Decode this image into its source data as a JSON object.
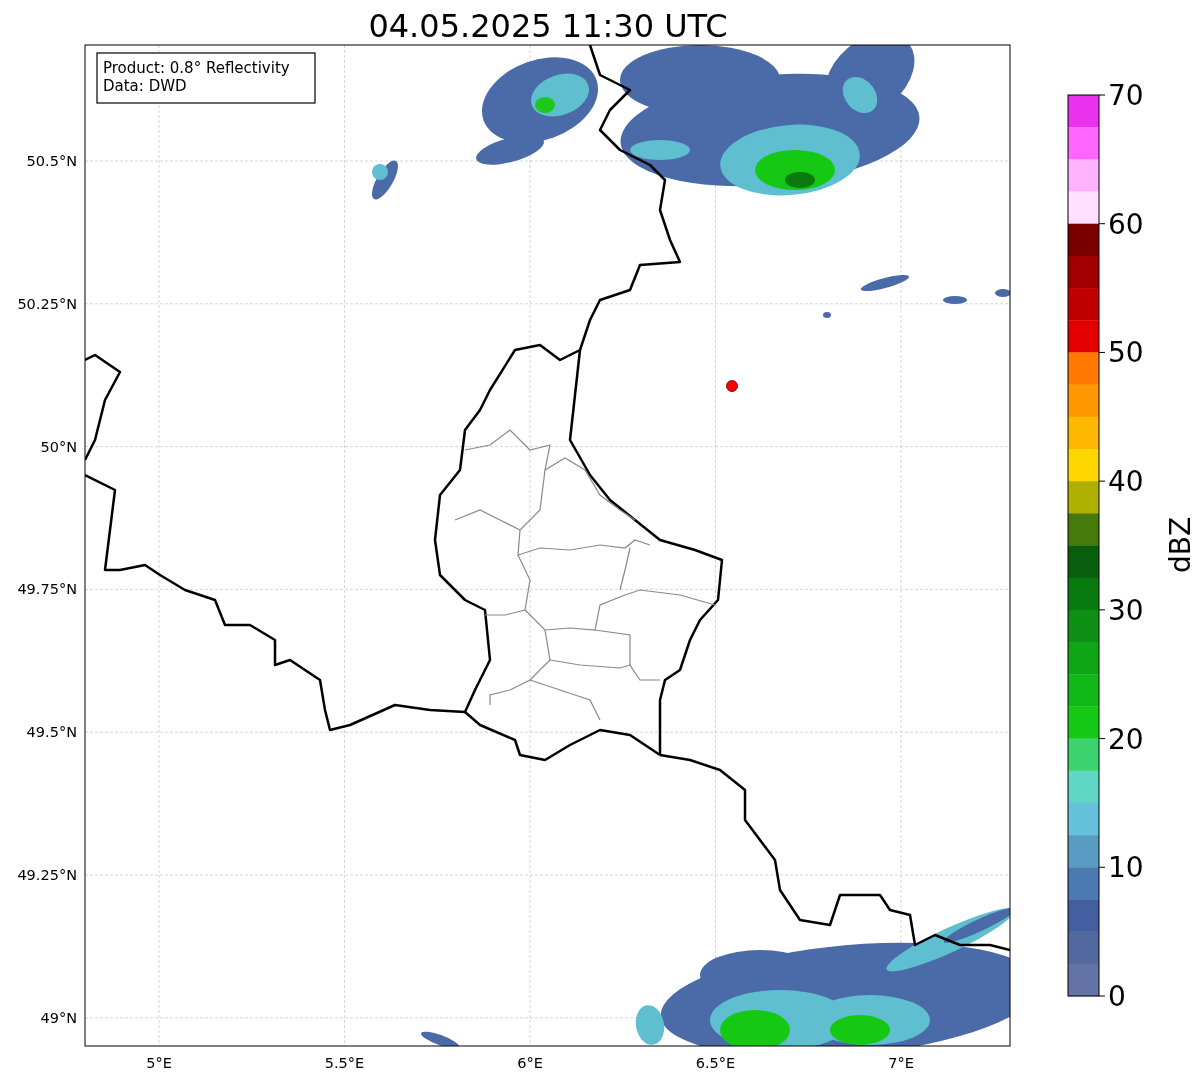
{
  "title": "04.05.2025 11:30 UTC",
  "legend": [
    "Product: 0.8° Reflectivity",
    "Data: DWD"
  ],
  "map": {
    "kind": "map",
    "lon_ticks": [
      "5°E",
      "5.5°E",
      "6°E",
      "6.5°E",
      "7°E"
    ],
    "lat_ticks": [
      "50.5°N",
      "50.25°N",
      "50°N",
      "49.75°N",
      "49.5°N",
      "49.25°N",
      "49°N"
    ]
  },
  "colorbar": {
    "label": "dBZ",
    "ticks": [
      "70",
      "60",
      "50",
      "40",
      "30",
      "20",
      "10",
      "0"
    ],
    "bands": [
      {
        "color": "#ea32ee"
      },
      {
        "color": "#ff66ff"
      },
      {
        "color": "#ffb3ff"
      },
      {
        "color": "#ffdeff"
      },
      {
        "color": "#7a0000"
      },
      {
        "color": "#a00000"
      },
      {
        "color": "#c00000"
      },
      {
        "color": "#e40000"
      },
      {
        "color": "#ff7800"
      },
      {
        "color": "#ff9800"
      },
      {
        "color": "#ffb800"
      },
      {
        "color": "#ffd700"
      },
      {
        "color": "#b0b000"
      },
      {
        "color": "#467a0a"
      },
      {
        "color": "#085e0c"
      },
      {
        "color": "#097a10"
      },
      {
        "color": "#0c8f12"
      },
      {
        "color": "#0ea614"
      },
      {
        "color": "#10b818"
      },
      {
        "color": "#14c814"
      },
      {
        "color": "#3dd470"
      },
      {
        "color": "#60d6c4"
      },
      {
        "color": "#65c1dc"
      },
      {
        "color": "#5a9bc4"
      },
      {
        "color": "#4a7ab0"
      },
      {
        "color": "#435fa0"
      },
      {
        "color": "#5468a0"
      },
      {
        "color": "#6373a6"
      }
    ]
  }
}
